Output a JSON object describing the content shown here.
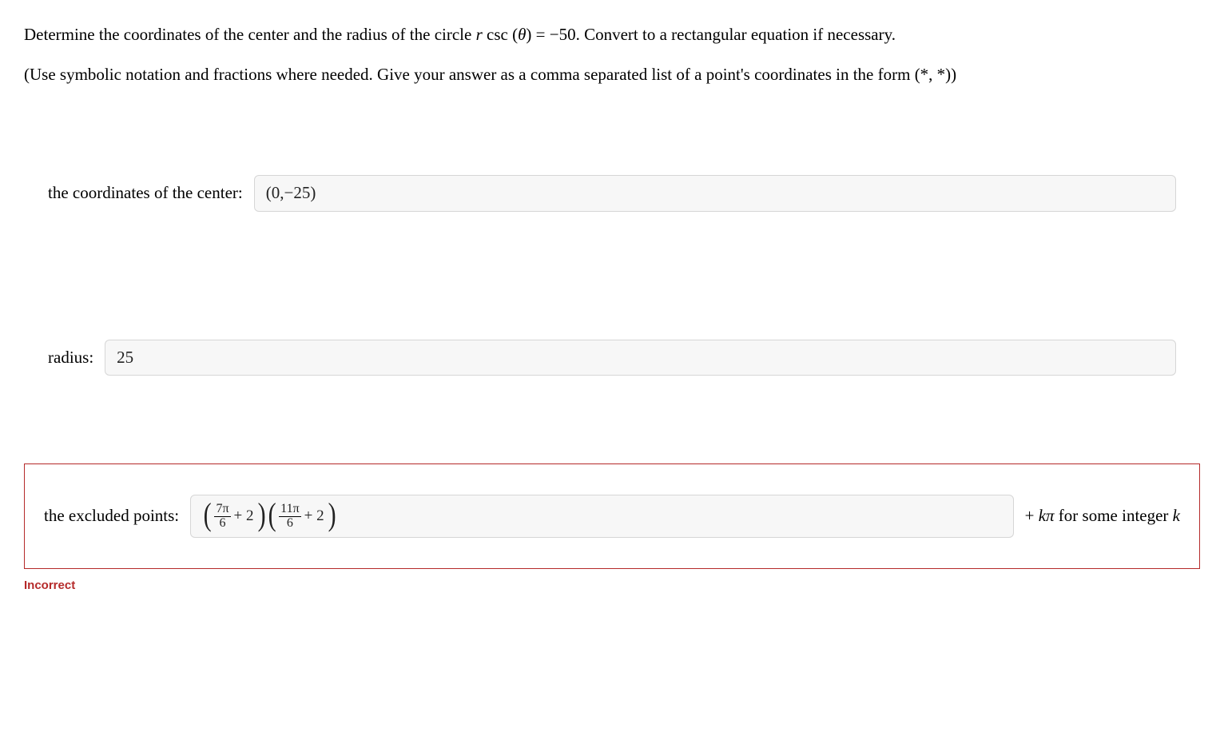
{
  "question": {
    "line1_pre": "Determine the coordinates of the center and the radius of the circle ",
    "line1_var": "r",
    "line1_mid": " csc (",
    "line1_theta": "θ",
    "line1_post": ") = −50. Convert to a rectangular equation if necessary.",
    "instructions": "(Use symbolic notation and fractions where needed. Give your answer as a comma separated list of a point's coordinates in the form (*, *))"
  },
  "answers": {
    "center": {
      "label": "the coordinates of the center:",
      "value": "(0,−25)"
    },
    "radius": {
      "label": "radius:",
      "value": "25"
    },
    "excluded": {
      "label": "the excluded points:",
      "frac1_num": "7π",
      "frac1_den": "6",
      "plus1": "+ 2",
      "frac2_num": "11π",
      "frac2_den": "6",
      "plus2": "+ 2",
      "suffix_pre": "+ ",
      "suffix_k": "k",
      "suffix_pi": "π",
      "suffix_post": " for some integer ",
      "suffix_k2": "k"
    }
  },
  "feedback": "Incorrect"
}
